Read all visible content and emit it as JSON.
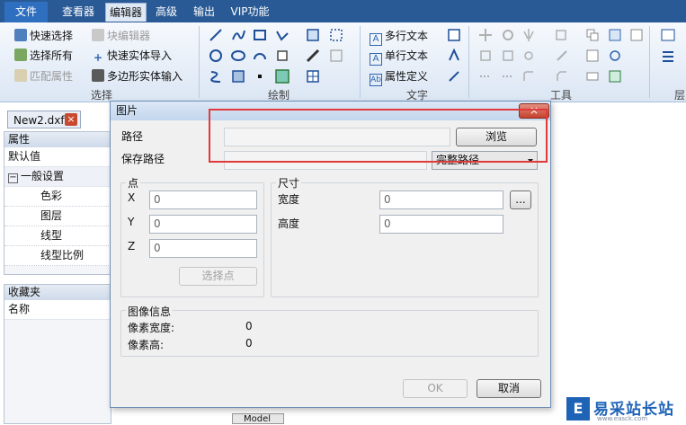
{
  "ribbon": {
    "tabs": [
      "文件",
      "查看器",
      "编辑器",
      "高级",
      "输出",
      "VIP功能"
    ],
    "active_tab": "编辑器",
    "select_group": {
      "label": "选择",
      "items": [
        "快速选择",
        "选择所有",
        "匹配属性",
        "块编辑器",
        "快速实体导入",
        "多边形实体输入"
      ]
    },
    "draw_group": {
      "label": "绘制"
    },
    "text_group": {
      "label": "文字",
      "items": [
        "多行文本",
        "单行文本",
        "属性定义"
      ]
    },
    "tools_group": {
      "label": "工具"
    },
    "layer_group": {
      "label": "层"
    }
  },
  "doc_tab": {
    "name": "New2.dxf",
    "close": "×"
  },
  "properties_panel": {
    "title": "属性",
    "default_row": "默认值",
    "section": "一般设置",
    "rows": [
      "色彩",
      "图层",
      "线型",
      "线型比例"
    ]
  },
  "favorites_panel": {
    "title": "收藏夹",
    "column": "名称"
  },
  "dialog": {
    "title": "图片",
    "close": "×",
    "path_label": "路径",
    "path_value": "",
    "browse": "浏览",
    "save_path_label": "保存路径",
    "save_path_value": "",
    "save_path_option": "完整路径",
    "point_group": "点",
    "x_label": "X",
    "x_value": "0",
    "y_label": "Y",
    "y_value": "0",
    "z_label": "Z",
    "z_value": "0",
    "select_point": "选择点",
    "size_group": "尺寸",
    "width_label": "宽度",
    "width_value": "0",
    "height_label": "高度",
    "height_value": "0",
    "more": "...",
    "image_info_group": "图像信息",
    "pixel_width_label": "像素宽度:",
    "pixel_width_value": "0",
    "pixel_height_label": "像素高:",
    "pixel_height_value": "0",
    "ok": "OK",
    "cancel": "取消"
  },
  "model_tab": "Model",
  "watermark": {
    "text": "易采站长站",
    "url": "www.easck.com",
    "logo": "E"
  },
  "colors": {
    "ribbon_blue": "#2a5a95",
    "highlight_red": "#e03a3a",
    "dialog_bg": "#f0f0f0"
  }
}
